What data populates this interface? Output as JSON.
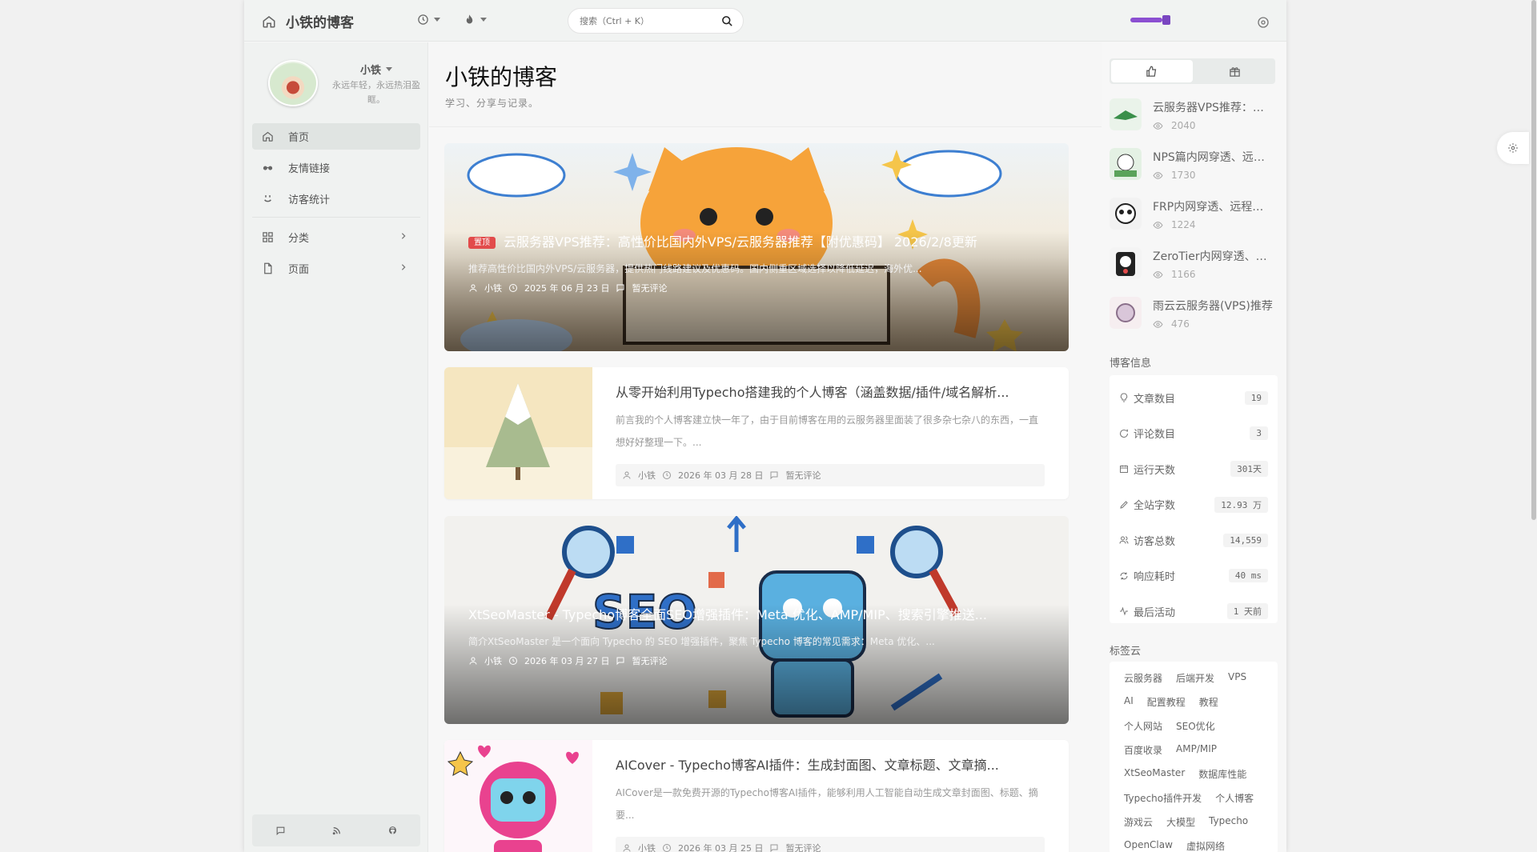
{
  "header": {
    "site_name": "小铁的博客",
    "search_placeholder": "搜索（Ctrl + K）",
    "icons": [
      "home-icon",
      "clock-icon",
      "fire-icon",
      "search-icon",
      "settings-icon"
    ]
  },
  "profile": {
    "name": "小铁",
    "motto": "永远年轻，永远热泪盈眶。"
  },
  "nav": {
    "items": [
      {
        "label": "首页",
        "icon": "home-icon"
      },
      {
        "label": "友情链接",
        "icon": "glasses-icon"
      },
      {
        "label": "访客统计",
        "icon": "smile-icon"
      },
      {
        "label": "分类",
        "icon": "grid-icon"
      },
      {
        "label": "页面",
        "icon": "file-icon"
      }
    ]
  },
  "page": {
    "title": "小铁的博客",
    "subtitle": "学习、分享与记录。"
  },
  "posts": [
    {
      "badge": "置顶",
      "title": "云服务器VPS推荐：高性价比国内外VPS/云服务器推荐【附优惠码】 2026/2/8更新",
      "excerpt": "推荐高性价比国内外VPS/云服务器，提供热门线路建议及优惠码。国内侧重区域选择以降低延迟，海外优...",
      "author": "小铁",
      "date": "2025 年 06 月 23 日",
      "comments": "暂无评论"
    },
    {
      "title": "从零开始利用Typecho搭建我的个人博客（涵盖数据/插件/域名解析...",
      "excerpt": "前言我的个人博客建立快一年了，由于目前博客在用的云服务器里面装了很多杂七杂八的东西，一直想好好整理一下。...",
      "author": "小铁",
      "date": "2026 年 03 月 28 日",
      "comments": "暂无评论"
    },
    {
      "title": "XtSeoMaster - Typecho博客全面SEO增强插件：Meta 优化、AMP/MIP、搜索引擎推送...",
      "excerpt": "简介XtSeoMaster 是一个面向 Typecho 的 SEO 增强插件，聚焦 Typecho 博客的常见需求：Meta 优化、...",
      "author": "小铁",
      "date": "2026 年 03 月 27 日",
      "comments": "暂无评论"
    },
    {
      "title": "AICover - Typecho博客AI插件：生成封面图、文章标题、文章摘...",
      "excerpt": "AICover是一款免费开源的Typecho博客AI插件，能够利用人工智能自动生成文章封面图、标题、摘要...",
      "author": "小铁",
      "date": "2026 年 03 月 25 日",
      "comments": "暂无评论"
    }
  ],
  "hot": [
    {
      "title": "云服务器VPS推荐：高性价比国内外VPS",
      "views": "2040"
    },
    {
      "title": "NPS篇内网穿透、远程桌面",
      "views": "1730"
    },
    {
      "title": "FRP内网穿透、远程桌面",
      "views": "1224"
    },
    {
      "title": "ZeroTier内网穿透、远程桌面",
      "views": "1166"
    },
    {
      "title": "雨云云服务器(VPS)推荐",
      "views": "476"
    }
  ],
  "stats": {
    "title": "博客信息",
    "rows": [
      {
        "label": "文章数目",
        "value": "19",
        "icon": "bulb-icon"
      },
      {
        "label": "评论数目",
        "value": "3",
        "icon": "comment-icon"
      },
      {
        "label": "运行天数",
        "value": "301天",
        "icon": "calendar-icon"
      },
      {
        "label": "全站字数",
        "value": "12.93 万",
        "icon": "pen-icon"
      },
      {
        "label": "访客总数",
        "value": "14,559",
        "icon": "users-icon"
      },
      {
        "label": "响应耗时",
        "value": "40 ms",
        "icon": "refresh-icon"
      },
      {
        "label": "最后活动",
        "value": "1 天前",
        "icon": "activity-icon"
      }
    ]
  },
  "tags": {
    "title": "标签云",
    "items": [
      "云服务器",
      "后端开发",
      "VPS",
      "AI",
      "配置教程",
      "教程",
      "个人网站",
      "SEO优化",
      "百度收录",
      "AMP/MIP",
      "XtSeoMaster",
      "数据库性能",
      "Typecho插件开发",
      "个人博客",
      "游戏云",
      "大模型",
      "Typecho",
      "OpenClaw",
      "虚拟网络"
    ]
  },
  "colors": {
    "accent_progress": "#8b4fd1",
    "pin_badge": "#e24b4b"
  }
}
